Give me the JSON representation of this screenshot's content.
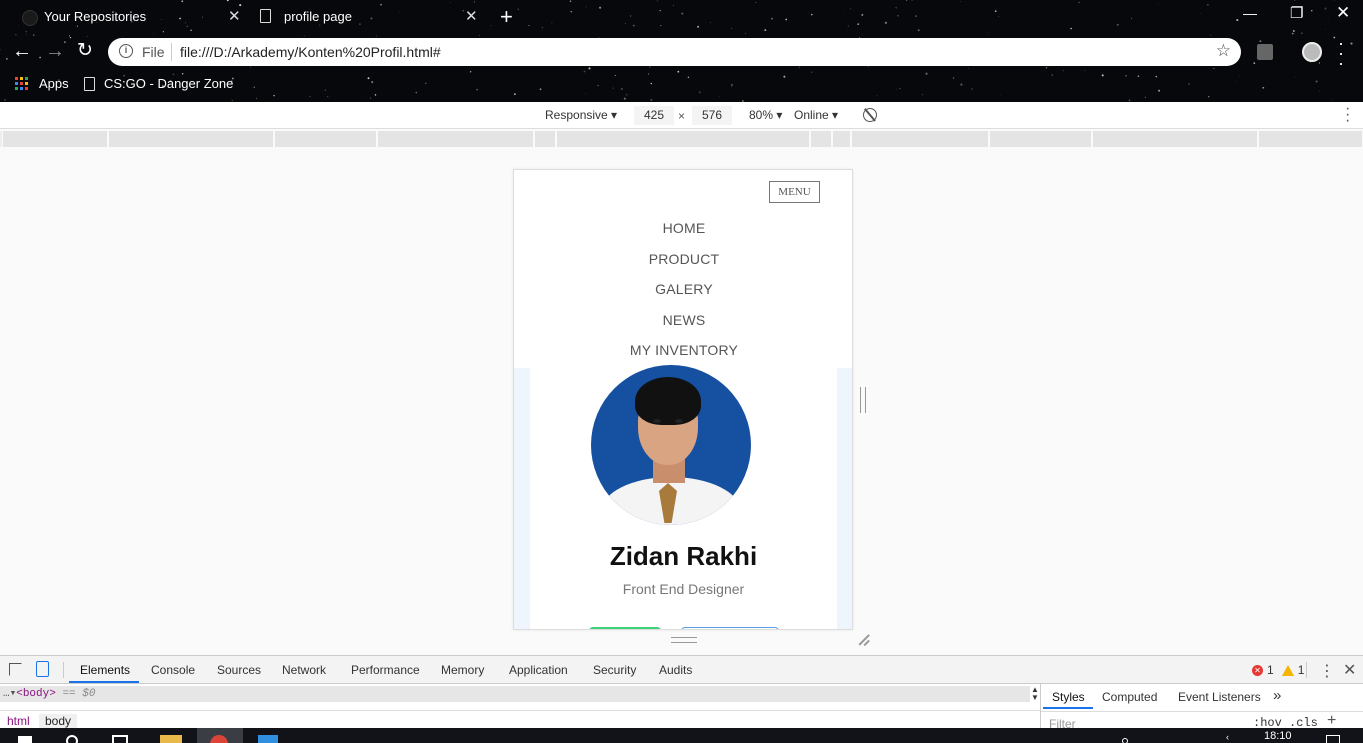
{
  "browser": {
    "tabs": [
      {
        "title": "Your Repositories",
        "icon": "github-icon"
      },
      {
        "title": "profile page",
        "icon": "page-icon"
      }
    ],
    "address": {
      "scheme_label": "File",
      "url": "file:///D:/Arkademy/Konten%20Profil.html#"
    },
    "bookmarks": [
      {
        "label": "Apps",
        "icon": "apps-grid-icon"
      },
      {
        "label": "CS:GO - Danger Zone",
        "icon": "page-icon"
      }
    ]
  },
  "device_toolbar": {
    "device": "Responsive",
    "width": "425",
    "times": "×",
    "height": "576",
    "zoom": "80%",
    "network": "Online"
  },
  "page": {
    "menu_button": "MENU",
    "nav_items": [
      "HOME",
      "PRODUCT",
      "GALERY",
      "NEWS",
      "MY INVENTORY"
    ],
    "profile": {
      "name": "Zidan Rakhi",
      "role": "Front End Designer"
    },
    "colors": {
      "photo_bg": "#1650a0",
      "primary_button": "#3fd17a",
      "secondary_button_border": "#5aa0e6",
      "card_bg": "#eef5fd"
    }
  },
  "devtools": {
    "tabs": [
      "Elements",
      "Console",
      "Sources",
      "Network",
      "Performance",
      "Memory",
      "Application",
      "Security",
      "Audits"
    ],
    "active_tab": "Elements",
    "errors": "1",
    "warnings": "1",
    "dom_prefix": "…",
    "dom_node": "<body>",
    "dom_suffix": "== $0",
    "breadcrumbs": [
      "html",
      "body"
    ],
    "styles_tabs": [
      "Styles",
      "Computed",
      "Event Listeners"
    ],
    "styles_more": "»",
    "filter_placeholder": "Filter",
    "hov_cls": ":hov .cls"
  },
  "taskbar": {
    "time": "18:10"
  }
}
